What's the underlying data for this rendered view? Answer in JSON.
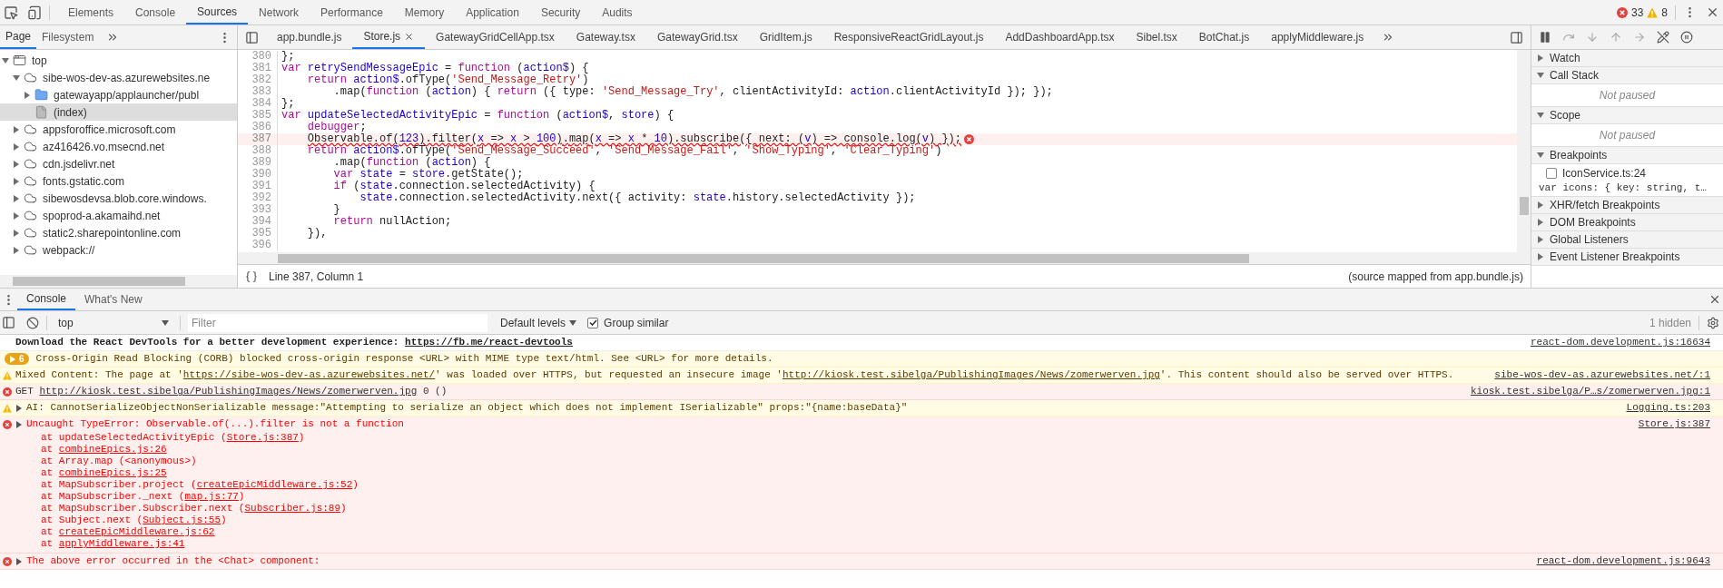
{
  "top_toolbar": {
    "tabs": [
      {
        "label": "Elements",
        "selected": false
      },
      {
        "label": "Console",
        "selected": false
      },
      {
        "label": "Sources",
        "selected": true
      },
      {
        "label": "Network",
        "selected": false
      },
      {
        "label": "Performance",
        "selected": false
      },
      {
        "label": "Memory",
        "selected": false
      },
      {
        "label": "Application",
        "selected": false
      },
      {
        "label": "Security",
        "selected": false
      },
      {
        "label": "Audits",
        "selected": false
      }
    ],
    "error_count": "33",
    "warning_count": "8"
  },
  "sources": {
    "navigator": {
      "tabs": [
        {
          "label": "Page",
          "selected": true
        },
        {
          "label": "Filesystem",
          "selected": false
        }
      ],
      "tree": [
        {
          "label": "top",
          "kind": "frame",
          "expanded": true,
          "selected": false,
          "children": [
            {
              "label": "sibe-wos-dev-as.azurewebsites.ne",
              "kind": "domain",
              "expanded": true,
              "selected": false,
              "children": [
                {
                  "label": "gatewayapp/applauncher/publ",
                  "kind": "folder",
                  "expanded": false,
                  "selected": false
                },
                {
                  "label": "(index)",
                  "kind": "file",
                  "selected": true
                }
              ]
            },
            {
              "label": "appsforoffice.microsoft.com",
              "kind": "domain",
              "expanded": false,
              "selected": false
            },
            {
              "label": "az416426.vo.msecnd.net",
              "kind": "domain",
              "expanded": false,
              "selected": false
            },
            {
              "label": "cdn.jsdelivr.net",
              "kind": "domain",
              "expanded": false,
              "selected": false
            },
            {
              "label": "fonts.gstatic.com",
              "kind": "domain",
              "expanded": false,
              "selected": false
            },
            {
              "label": "sibewosdevsa.blob.core.windows.",
              "kind": "domain",
              "expanded": false,
              "selected": false
            },
            {
              "label": "spoprod-a.akamaihd.net",
              "kind": "domain",
              "expanded": false,
              "selected": false
            },
            {
              "label": "static2.sharepointonline.com",
              "kind": "domain",
              "expanded": false,
              "selected": false
            },
            {
              "label": "webpack://",
              "kind": "domain",
              "expanded": false,
              "selected": false
            }
          ]
        }
      ]
    },
    "editor": {
      "file_tabs": [
        {
          "label": "app.bundle.js",
          "selected": false
        },
        {
          "label": "Store.js",
          "selected": true
        },
        {
          "label": "GatewayGridCellApp.tsx",
          "selected": false
        },
        {
          "label": "Gateway.tsx",
          "selected": false
        },
        {
          "label": "GatewayGrid.tsx",
          "selected": false
        },
        {
          "label": "GridItem.js",
          "selected": false
        },
        {
          "label": "ResponsiveReactGridLayout.js",
          "selected": false
        },
        {
          "label": "AddDashboardApp.tsx",
          "selected": false
        },
        {
          "label": "Sibel.tsx",
          "selected": false
        },
        {
          "label": "BotChat.js",
          "selected": false
        },
        {
          "label": "applyMiddleware.js",
          "selected": false
        }
      ],
      "lines": [
        {
          "number": "380",
          "error": false,
          "segments": [
            {
              "kind": "plain",
              "text": "};"
            }
          ]
        },
        {
          "number": "381",
          "error": false,
          "segments": [
            {
              "kind": "keyword",
              "text": "var "
            },
            {
              "kind": "variable",
              "text": "retrySendMessageEpic"
            },
            {
              "kind": "plain",
              "text": " = "
            },
            {
              "kind": "keyword",
              "text": "function"
            },
            {
              "kind": "plain",
              "text": " ("
            },
            {
              "kind": "variable",
              "text": "action$"
            },
            {
              "kind": "plain",
              "text": ") {"
            }
          ]
        },
        {
          "number": "382",
          "error": false,
          "segments": [
            {
              "kind": "keyword",
              "text": "    return "
            },
            {
              "kind": "variable",
              "text": "action$"
            },
            {
              "kind": "plain",
              "text": ".ofType("
            },
            {
              "kind": "string",
              "text": "'Send_Message_Retry'"
            },
            {
              "kind": "plain",
              "text": ")"
            }
          ]
        },
        {
          "number": "383",
          "error": false,
          "segments": [
            {
              "kind": "plain",
              "text": "        .map("
            },
            {
              "kind": "keyword",
              "text": "function"
            },
            {
              "kind": "plain",
              "text": " ("
            },
            {
              "kind": "variable",
              "text": "action"
            },
            {
              "kind": "plain",
              "text": ") { "
            },
            {
              "kind": "keyword",
              "text": "return"
            },
            {
              "kind": "plain",
              "text": " ({ type: "
            },
            {
              "kind": "string",
              "text": "'Send_Message_Try'"
            },
            {
              "kind": "plain",
              "text": ", clientActivityId: "
            },
            {
              "kind": "variable",
              "text": "action"
            },
            {
              "kind": "plain",
              "text": ".clientActivityId }); });"
            }
          ]
        },
        {
          "number": "384",
          "error": false,
          "segments": [
            {
              "kind": "plain",
              "text": "};"
            }
          ]
        },
        {
          "number": "385",
          "error": false,
          "segments": [
            {
              "kind": "keyword",
              "text": "var "
            },
            {
              "kind": "variable",
              "text": "updateSelectedActivityEpic"
            },
            {
              "kind": "plain",
              "text": " = "
            },
            {
              "kind": "keyword",
              "text": "function"
            },
            {
              "kind": "plain",
              "text": " ("
            },
            {
              "kind": "variable",
              "text": "action$"
            },
            {
              "kind": "plain",
              "text": ", "
            },
            {
              "kind": "variable",
              "text": "store"
            },
            {
              "kind": "plain",
              "text": ") {"
            }
          ]
        },
        {
          "number": "386",
          "error": false,
          "segments": [
            {
              "kind": "keyword",
              "text": "    debugger"
            },
            {
              "kind": "plain",
              "text": ";"
            }
          ]
        },
        {
          "number": "387",
          "error": true,
          "segments": [
            {
              "kind": "plain",
              "text": "    Observable.of("
            },
            {
              "kind": "number",
              "text": "123"
            },
            {
              "kind": "plain",
              "text": ").filter("
            },
            {
              "kind": "variable",
              "text": "x"
            },
            {
              "kind": "plain",
              "text": " => "
            },
            {
              "kind": "variable",
              "text": "x"
            },
            {
              "kind": "plain",
              "text": " > "
            },
            {
              "kind": "number",
              "text": "100"
            },
            {
              "kind": "plain",
              "text": ").map("
            },
            {
              "kind": "variable",
              "text": "x"
            },
            {
              "kind": "plain",
              "text": " => "
            },
            {
              "kind": "variable",
              "text": "x"
            },
            {
              "kind": "plain",
              "text": " * "
            },
            {
              "kind": "number",
              "text": "10"
            },
            {
              "kind": "plain",
              "text": ").subscribe({ next: ("
            },
            {
              "kind": "variable",
              "text": "v"
            },
            {
              "kind": "plain",
              "text": ") => console.log("
            },
            {
              "kind": "variable",
              "text": "v"
            },
            {
              "kind": "plain",
              "text": ") });"
            }
          ]
        },
        {
          "number": "388",
          "error": false,
          "segments": [
            {
              "kind": "keyword",
              "text": "    return "
            },
            {
              "kind": "variable",
              "text": "action$"
            },
            {
              "kind": "plain",
              "text": ".ofType("
            },
            {
              "kind": "string",
              "text": "'Send_Message_Succeed'"
            },
            {
              "kind": "plain",
              "text": ", "
            },
            {
              "kind": "string",
              "text": "'Send_Message_Fail'"
            },
            {
              "kind": "plain",
              "text": ", "
            },
            {
              "kind": "string",
              "text": "'Show_Typing'"
            },
            {
              "kind": "plain",
              "text": ", "
            },
            {
              "kind": "string",
              "text": "'Clear_Typing'"
            },
            {
              "kind": "plain",
              "text": ")"
            }
          ]
        },
        {
          "number": "389",
          "error": false,
          "segments": [
            {
              "kind": "plain",
              "text": "        .map("
            },
            {
              "kind": "keyword",
              "text": "function"
            },
            {
              "kind": "plain",
              "text": " ("
            },
            {
              "kind": "variable",
              "text": "action"
            },
            {
              "kind": "plain",
              "text": ") {"
            }
          ]
        },
        {
          "number": "390",
          "error": false,
          "segments": [
            {
              "kind": "keyword",
              "text": "        var "
            },
            {
              "kind": "variable",
              "text": "state"
            },
            {
              "kind": "plain",
              "text": " = "
            },
            {
              "kind": "variable",
              "text": "store"
            },
            {
              "kind": "plain",
              "text": ".getState();"
            }
          ]
        },
        {
          "number": "391",
          "error": false,
          "segments": [
            {
              "kind": "keyword",
              "text": "        if"
            },
            {
              "kind": "plain",
              "text": " ("
            },
            {
              "kind": "variable",
              "text": "state"
            },
            {
              "kind": "plain",
              "text": ".connection.selectedActivity) {"
            }
          ]
        },
        {
          "number": "392",
          "error": false,
          "segments": [
            {
              "kind": "variable",
              "text": "            state"
            },
            {
              "kind": "plain",
              "text": ".connection.selectedActivity.next({ activity: "
            },
            {
              "kind": "variable",
              "text": "state"
            },
            {
              "kind": "plain",
              "text": ".history.selectedActivity });"
            }
          ]
        },
        {
          "number": "393",
          "error": false,
          "segments": [
            {
              "kind": "plain",
              "text": "        }"
            }
          ]
        },
        {
          "number": "394",
          "error": false,
          "segments": [
            {
              "kind": "keyword",
              "text": "        return"
            },
            {
              "kind": "plain",
              "text": " nullAction;"
            }
          ]
        },
        {
          "number": "395",
          "error": false,
          "segments": [
            {
              "kind": "plain",
              "text": "    }),"
            }
          ]
        },
        {
          "number": "396",
          "error": false
        }
      ],
      "status": {
        "position": "Line 387, Column 1",
        "source_map": "(source mapped from app.bundle.js)"
      }
    },
    "debugger": {
      "sections": [
        {
          "title": "Watch",
          "expanded": false
        },
        {
          "title": "Call Stack",
          "expanded": true,
          "message": "Not paused"
        },
        {
          "title": "Scope",
          "expanded": true,
          "message": "Not paused"
        },
        {
          "title": "Breakpoints",
          "expanded": true,
          "items": [
            {
              "label": "IconService.ts:24",
              "checked": false,
              "code": "var icons: { key: string, t…"
            }
          ]
        },
        {
          "title": "XHR/fetch Breakpoints",
          "expanded": false
        },
        {
          "title": "DOM Breakpoints",
          "expanded": false
        },
        {
          "title": "Global Listeners",
          "expanded": false
        },
        {
          "title": "Event Listener Breakpoints",
          "expanded": false
        }
      ]
    }
  },
  "console": {
    "drawer_tabs": [
      {
        "label": "Console",
        "selected": true
      },
      {
        "label": "What's New",
        "selected": false
      }
    ],
    "context": "top",
    "filter_placeholder": "Filter",
    "levels": "Default levels",
    "group_similar": {
      "label": "Group similar",
      "checked": true
    },
    "hidden": "1 hidden",
    "messages": [
      {
        "kind": "info",
        "bold": true,
        "expandable": false,
        "segments": [
          {
            "kind": "text",
            "text": "Download the React DevTools for a better development experience: "
          },
          {
            "kind": "link",
            "text": "https://fb.me/react-devtools"
          }
        ],
        "source": "react-dom.development.js:16634"
      },
      {
        "kind": "warning",
        "bold": false,
        "expandable": false,
        "count": "6",
        "segments": [
          {
            "kind": "text",
            "text": "Cross-Origin Read Blocking (CORB) blocked cross-origin response <URL> with MIME type text/html. See <URL> for more details."
          }
        ]
      },
      {
        "kind": "warning",
        "bold": false,
        "expandable": false,
        "segments": [
          {
            "kind": "text",
            "text": "Mixed Content: The page at '"
          },
          {
            "kind": "link",
            "text": "https://sibe-wos-dev-as.azurewebsites.net/"
          },
          {
            "kind": "text",
            "text": "' was loaded over HTTPS, but requested an insecure image '"
          },
          {
            "kind": "link",
            "text": "http://kiosk.test.sibelga/PublishingImages/News/zomerwerven.jpg"
          },
          {
            "kind": "text",
            "text": "'. This content should also be served over HTTPS."
          }
        ],
        "source": "sibe-wos-dev-as.azurewebsites.net/:1"
      },
      {
        "kind": "network-error",
        "bold": false,
        "expandable": false,
        "segments": [
          {
            "kind": "text",
            "text": "GET "
          },
          {
            "kind": "link",
            "text": "http://kiosk.test.sibelga/PublishingImages/News/zomerwerven.jpg"
          },
          {
            "kind": "text",
            "text": " 0 ()"
          }
        ],
        "source": "kiosk.test.sibelga/P…s/zomerwerven.jpg:1"
      },
      {
        "kind": "warning",
        "bold": false,
        "expandable": true,
        "segments": [
          {
            "kind": "text",
            "text": "AI: CannotSerializeObjectNonSerializable message:\"Attempting to serialize an object which does not implement ISerializable\" props:\"{name:baseData}\""
          }
        ],
        "source": "Logging.ts:203"
      },
      {
        "kind": "error",
        "bold": false,
        "expandable": true,
        "segments": [
          {
            "kind": "text",
            "text": "Uncaught TypeError: Observable.of(...).filter is not a function"
          }
        ],
        "source": "Store.js:387",
        "stack": [
          {
            "segments": [
              {
                "kind": "text",
                "text": "at updateSelectedActivityEpic ("
              },
              {
                "kind": "link",
                "text": "Store.js:387"
              },
              {
                "kind": "text",
                "text": ")"
              }
            ]
          },
          {
            "segments": [
              {
                "kind": "text",
                "text": "at "
              },
              {
                "kind": "link",
                "text": "combineEpics.js:26"
              }
            ]
          },
          {
            "segments": [
              {
                "kind": "text",
                "text": "at Array.map (<anonymous>)"
              }
            ]
          },
          {
            "segments": [
              {
                "kind": "text",
                "text": "at "
              },
              {
                "kind": "link",
                "text": "combineEpics.js:25"
              }
            ]
          },
          {
            "segments": [
              {
                "kind": "text",
                "text": "at MapSubscriber.project ("
              },
              {
                "kind": "link",
                "text": "createEpicMiddleware.js:52"
              },
              {
                "kind": "text",
                "text": ")"
              }
            ]
          },
          {
            "segments": [
              {
                "kind": "text",
                "text": "at MapSubscriber._next ("
              },
              {
                "kind": "link",
                "text": "map.js:77"
              },
              {
                "kind": "text",
                "text": ")"
              }
            ]
          },
          {
            "segments": [
              {
                "kind": "text",
                "text": "at MapSubscriber.Subscriber.next ("
              },
              {
                "kind": "link",
                "text": "Subscriber.js:89"
              },
              {
                "kind": "text",
                "text": ")"
              }
            ]
          },
          {
            "segments": [
              {
                "kind": "text",
                "text": "at Subject.next ("
              },
              {
                "kind": "link",
                "text": "Subject.js:55"
              },
              {
                "kind": "text",
                "text": ")"
              }
            ]
          },
          {
            "segments": [
              {
                "kind": "text",
                "text": "at "
              },
              {
                "kind": "link",
                "text": "createEpicMiddleware.js:62"
              }
            ]
          },
          {
            "segments": [
              {
                "kind": "text",
                "text": "at "
              },
              {
                "kind": "link",
                "text": "applyMiddleware.js:41"
              }
            ]
          }
        ]
      },
      {
        "kind": "error",
        "bold": false,
        "expandable": true,
        "segments": [
          {
            "kind": "text",
            "text": "The above error occurred in the <Chat> component:"
          }
        ],
        "source": "react-dom.development.js:9643"
      }
    ]
  }
}
